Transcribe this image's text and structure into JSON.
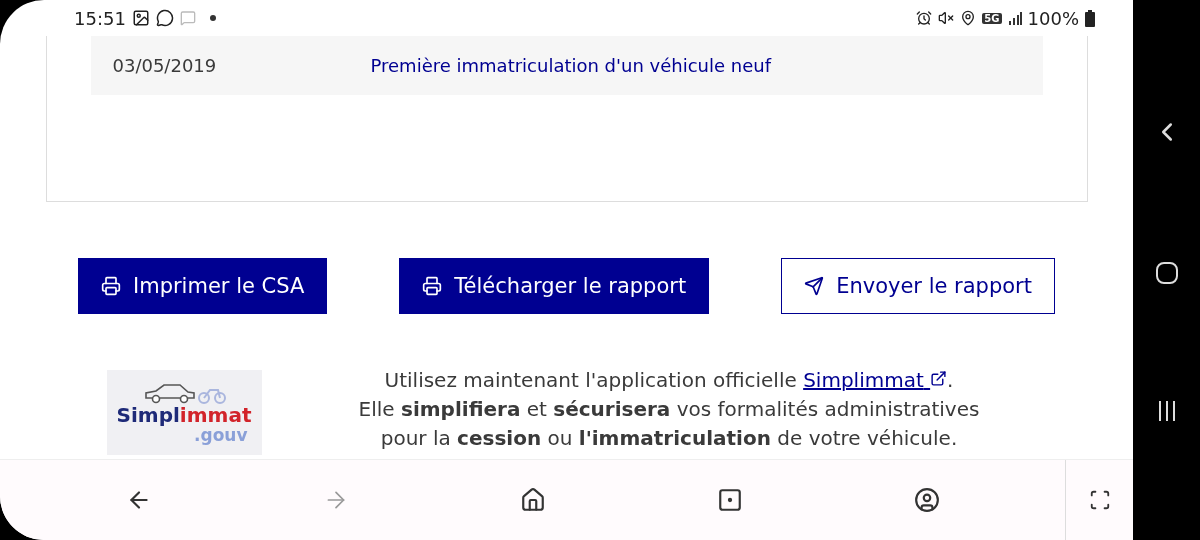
{
  "status_bar": {
    "time": "15:51",
    "network": "5G",
    "battery": "100%"
  },
  "history_table": {
    "rows": [
      {
        "date": "03/05/2019",
        "event": "Première immatriculation d'un véhicule neuf"
      }
    ]
  },
  "actions": [
    {
      "label": "Imprimer le CSA",
      "kind": "print"
    },
    {
      "label": "Télécharger le rapport",
      "kind": "print"
    },
    {
      "label": "Envoyer le rapport",
      "kind": "send"
    }
  ],
  "promo": {
    "logo": {
      "part_1": "Simpl",
      "part_2": "immat",
      "part_3": ".gouv"
    },
    "lines": [
      "Utilisez maintenant l'application officielle",
      "Elle **simplifiera** et **sécurisera** vos formalités administratives",
      "pour la **cession** ou **l'immatriculation** de votre véhicule."
    ],
    "link": "Simplimmat",
    "after_link": "."
  },
  "browser_bar": {
    "buttons": [
      {
        "kind": "back",
        "disabled": false
      },
      {
        "kind": "forward",
        "disabled": true
      },
      {
        "kind": "home",
        "disabled": false
      },
      {
        "kind": "tabs",
        "disabled": false
      },
      {
        "kind": "account",
        "disabled": false
      }
    ]
  }
}
